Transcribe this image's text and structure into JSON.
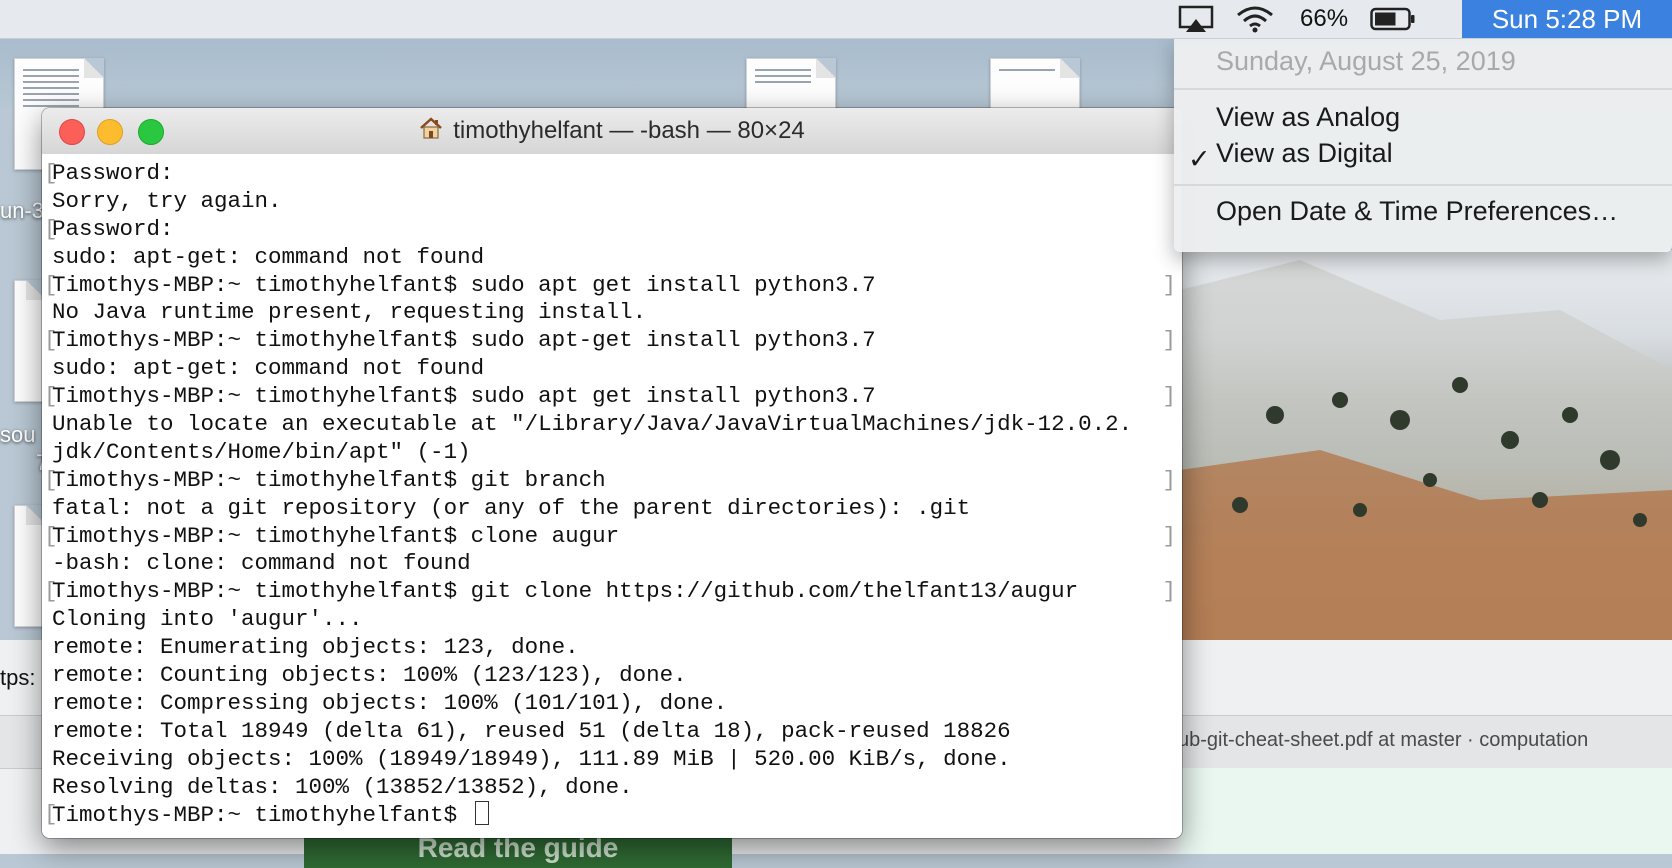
{
  "menubar": {
    "battery_percent": "66%",
    "clock": "Sun 5:28 PM",
    "airplay_icon": "airplay-icon",
    "wifi_icon": "wifi-icon",
    "battery_icon": "battery-icon",
    "battery_level": 0.66
  },
  "clock_menu": {
    "date": "Sunday, August 25, 2019",
    "items": [
      "View as Analog",
      "View as Digital",
      "Open Date & Time Preferences…"
    ],
    "checked": "View as Digital",
    "check_mark": "✓"
  },
  "desktop": {
    "label_1": "un-3",
    "label_2": "sou",
    "label_3": "7"
  },
  "browser": {
    "url_fragment": "tps:",
    "tab_title": "ub-git-cheat-sheet.pdf at master · computation",
    "guide_button": "Read the guide"
  },
  "terminal": {
    "title": "timothyhelfant — -bash — 80×24",
    "lines": [
      "Password:",
      "Sorry, try again.",
      "Password:",
      "sudo: apt-get: command not found",
      "Timothys-MBP:~ timothyhelfant$ sudo apt get install python3.7",
      "No Java runtime present, requesting install.",
      "Timothys-MBP:~ timothyhelfant$ sudo apt-get install python3.7",
      "sudo: apt-get: command not found",
      "Timothys-MBP:~ timothyhelfant$ sudo apt get install python3.7",
      "Unable to locate an executable at \"/Library/Java/JavaVirtualMachines/jdk-12.0.2.",
      "jdk/Contents/Home/bin/apt\" (-1)",
      "Timothys-MBP:~ timothyhelfant$ git branch",
      "fatal: not a git repository (or any of the parent directories): .git",
      "Timothys-MBP:~ timothyhelfant$ clone augur",
      "-bash: clone: command not found",
      "Timothys-MBP:~ timothyhelfant$ git clone https://github.com/thelfant13/augur",
      "Cloning into 'augur'...",
      "remote: Enumerating objects: 123, done.",
      "remote: Counting objects: 100% (123/123), done.",
      "remote: Compressing objects: 100% (101/101), done.",
      "remote: Total 18949 (delta 61), reused 51 (delta 18), pack-reused 18826",
      "Receiving objects: 100% (18949/18949), 111.89 MiB | 520.00 KiB/s, done.",
      "Resolving deltas: 100% (13852/13852), done.",
      "Timothys-MBP:~ timothyhelfant$ "
    ]
  }
}
